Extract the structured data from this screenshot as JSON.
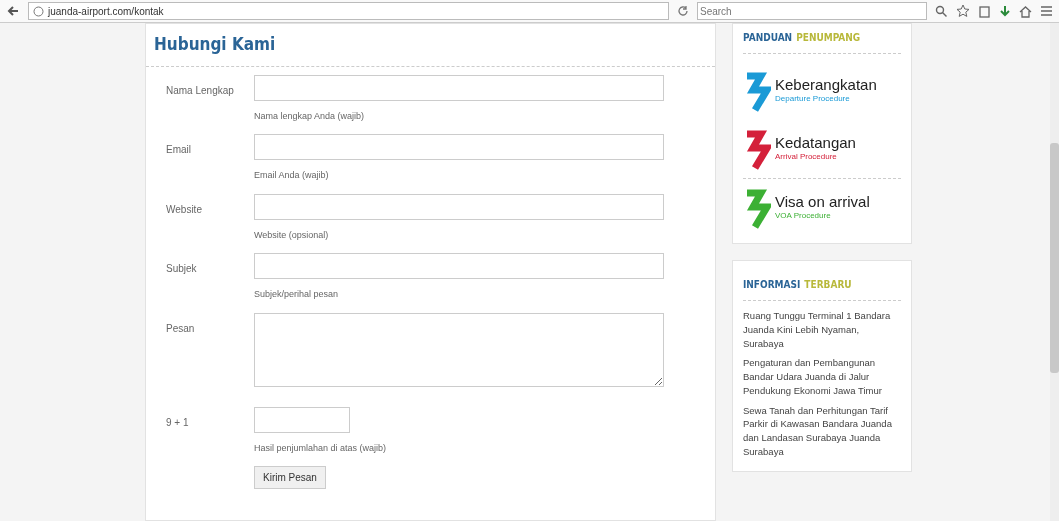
{
  "browser": {
    "url": "juanda-airport.com/kontak",
    "search": {
      "placeholder": "Search"
    }
  },
  "form": {
    "title": "Hubungi Kami",
    "fields": [
      {
        "kind": "input",
        "label": "Nama Lengkap",
        "help": "Nama lengkap Anda (wajib)"
      },
      {
        "kind": "input",
        "label": "Email",
        "help": "Email Anda (wajib)"
      },
      {
        "kind": "input",
        "label": "Website",
        "help": "Website (opsional)"
      },
      {
        "kind": "input",
        "label": "Subjek",
        "help": "Subjek/perihal pesan"
      },
      {
        "kind": "textarea",
        "label": "Pesan"
      },
      {
        "kind": "captcha",
        "label": "9 + 1",
        "help": "Hasil penjumlahan di atas (wajib)"
      }
    ],
    "submit": "Kirim Pesan"
  },
  "sidebar": {
    "guide": {
      "title_a": "PANDUAN",
      "title_b": "PENUMPANG",
      "items": [
        {
          "title": "Keberangkatan",
          "subtitle": "Departure Procedure",
          "color": "#1a9ad6"
        },
        {
          "title": "Kedatangan",
          "subtitle": "Arrival Procedure",
          "color": "#d4203a"
        },
        {
          "title": "Visa on arrival",
          "subtitle": "VOA Procedure",
          "color": "#3cb034"
        }
      ]
    },
    "news": {
      "title_a": "INFORMASI",
      "title_b": "TERBARU",
      "items": [
        "Ruang Tunggu Terminal 1 Bandara Juanda Kini Lebih Nyaman, Surabaya",
        "Pengaturan dan Pembangunan Bandar Udara Juanda di Jalur Pendukung Ekonomi Jawa Timur",
        "Sewa Tanah dan Perhitungan Tarif Parkir di Kawasan Bandara Juanda dan Landasan Surabaya Juanda Surabaya"
      ]
    }
  }
}
